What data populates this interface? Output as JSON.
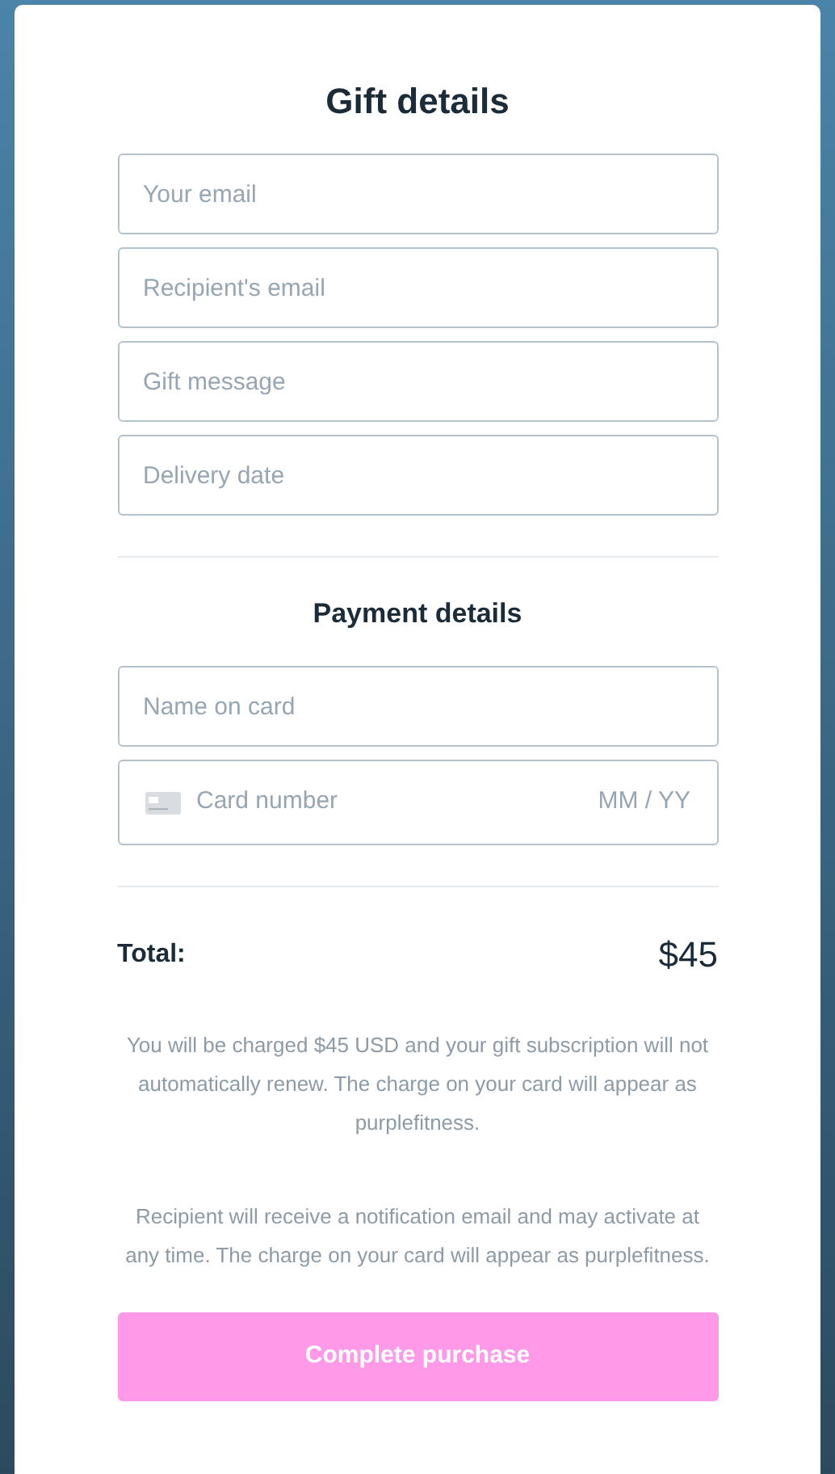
{
  "title": "Gift details",
  "gift_fields": [
    {
      "placeholder": "Your email"
    },
    {
      "placeholder": "Recipient's email"
    },
    {
      "placeholder": "Gift message"
    },
    {
      "placeholder": "Delivery date"
    }
  ],
  "payment": {
    "title": "Payment details",
    "name_field": {
      "placeholder": "Name on card"
    },
    "card_field": {
      "placeholder": "Card number",
      "expiry_placeholder": "MM / YY"
    }
  },
  "total": {
    "label": "Total:",
    "amount": "$45"
  },
  "notes": [
    "You will be charged $45 USD and your gift subscription will not automatically renew. The charge on your card will appear as purplefitness.",
    "Recipient will receive a notification email and may activate at any time. The charge on your card will appear as purplefitness."
  ],
  "submit": {
    "label": "Complete purchase",
    "disabled": true
  }
}
